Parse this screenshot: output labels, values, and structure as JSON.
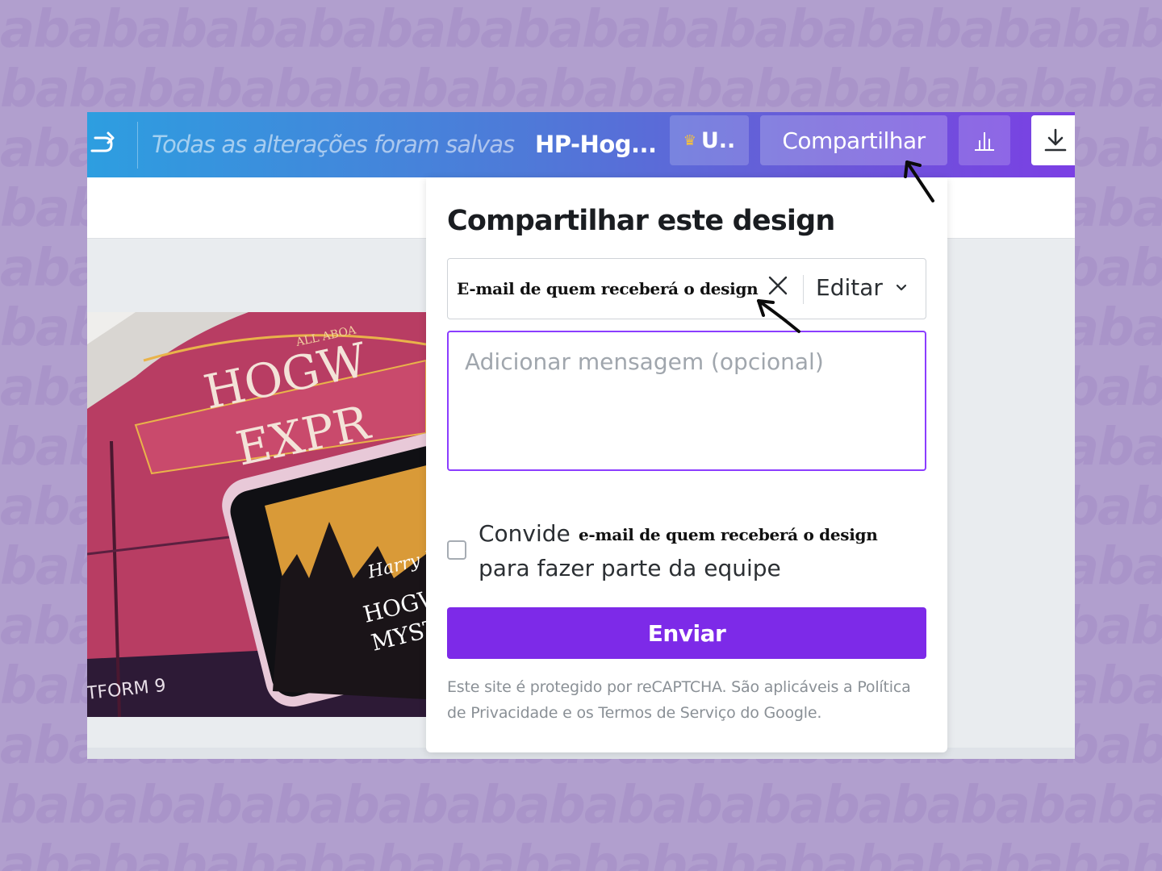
{
  "toolbar": {
    "saved_status": "Todas as alterações foram salvas",
    "doc_title": "HP-Hog...",
    "upgrade_label": "U..",
    "share_label": "Compartilhar"
  },
  "dialog": {
    "title": "Compartilhar este design",
    "email_chip": "E-mail de quem receberá o design",
    "permission": "Editar",
    "message_placeholder": "Adicionar mensagem (opcional)",
    "invite_prefix": "Convide",
    "invite_email": "e-mail de quem receberá o design",
    "invite_suffix": "para fazer parte da equipe",
    "send_label": "Enviar",
    "recaptcha_note": "Este site é protegido por reCAPTCHA. São aplicáveis a Política de Privacidade e os Termos de Serviço do Google."
  },
  "colors": {
    "page_bg": "#b19fce",
    "accent": "#7d2ae8",
    "topbar_start": "#2d9ee0",
    "topbar_end": "#7b3fe4"
  },
  "icons": [
    "redo-icon",
    "crown-icon",
    "bar-chart-icon",
    "download-icon",
    "close-icon",
    "chevron-down-icon"
  ]
}
